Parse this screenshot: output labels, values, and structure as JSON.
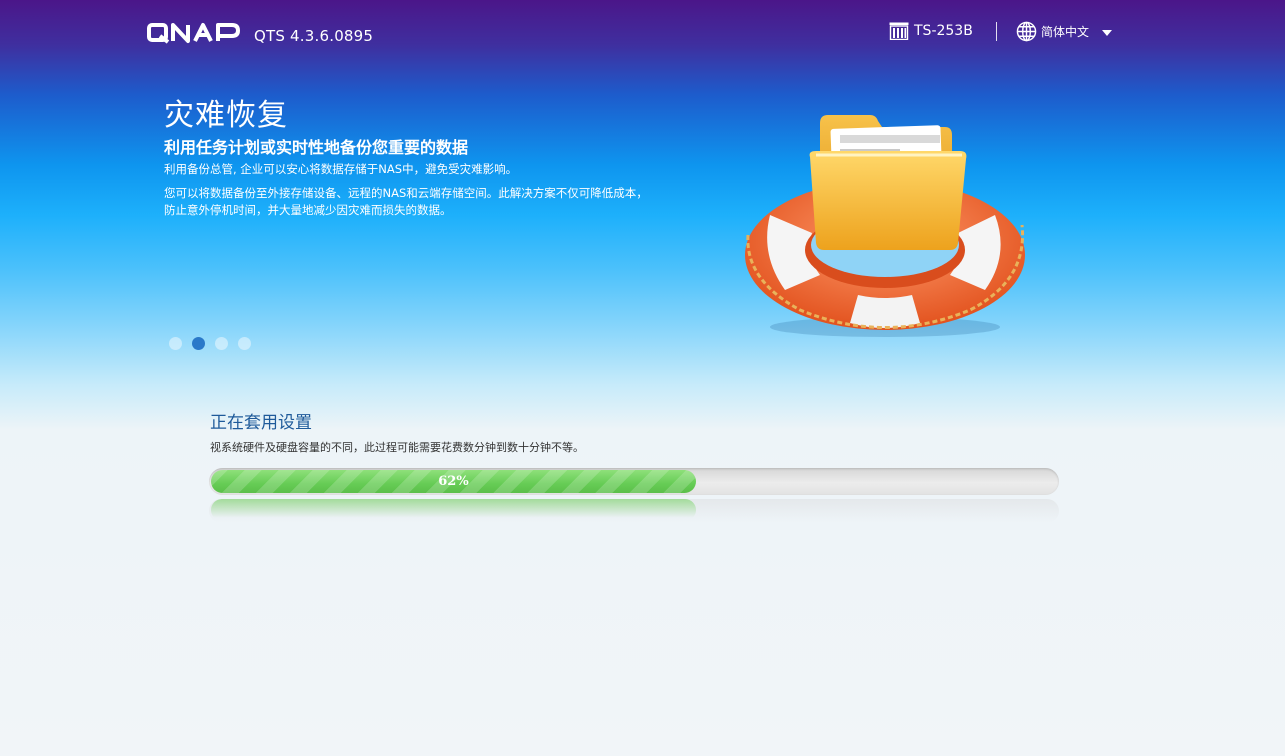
{
  "header": {
    "brand_logo_text": "QNAP",
    "version": "QTS 4.3.6.0895",
    "device_icon": "nas-device-icon",
    "device_name": "TS-253B",
    "language_icon": "globe-icon",
    "language": "简体中文",
    "language_caret_icon": "caret-down-icon"
  },
  "slide": {
    "title": "灾难恢复",
    "subtitle": "利用任务计划或实时性地备份您重要的数据",
    "paragraph1": "利用备份总管, 企业可以安心将数据存储于NAS中，避免受灾难影响。",
    "paragraph2": "您可以将数据备份至外接存储设备、远程的NAS和云端存储空间。此解决方案不仅可降低成本，防止意外停机时间，并大量地减少因灾难而损失的数据。",
    "illustration_icon": "life-buoy-folder-icon",
    "pagination": {
      "count": 4,
      "active_index": 1
    }
  },
  "status": {
    "title": "正在套用设置",
    "description": "视系统硬件及硬盘容量的不同，此过程可能需要花费数分钟到数十分钟不等。",
    "progress_percent": 62,
    "progress_label": "62%",
    "progress_color": "#66cc55"
  },
  "colors": {
    "header_top": "#4b1689",
    "sky_blue": "#1db0fb",
    "title_blue": "#1e5a9a",
    "dot_active": "#2a79c9"
  }
}
